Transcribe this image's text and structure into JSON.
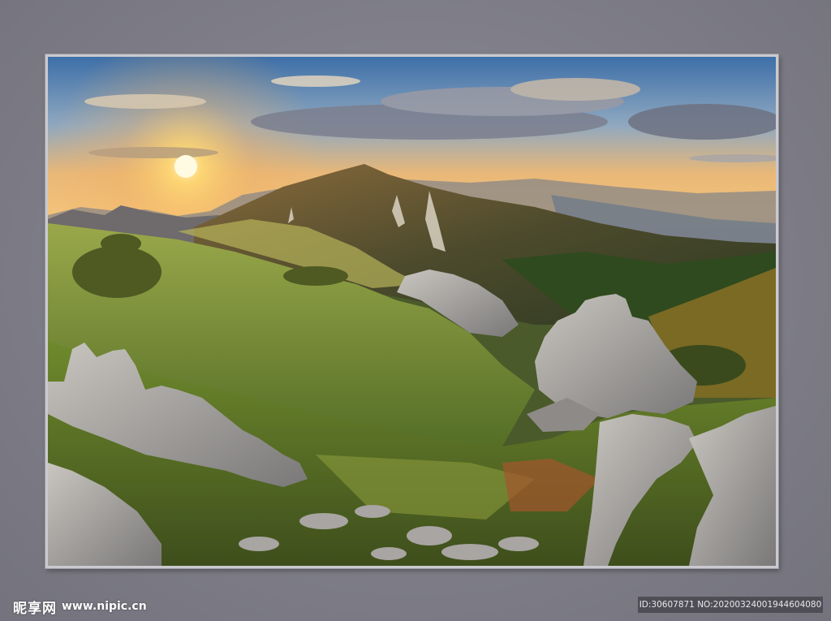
{
  "watermark": {
    "brand": "昵享网",
    "url": "www.nipic.cn",
    "id_text": "ID:30607871 NO:20200324001944604080"
  },
  "colors": {
    "wall": "#7f7e88",
    "frame": "#c9c9cf",
    "sky_top": "#3d6fa8",
    "sun": "#ffd873",
    "grass": "#6c8a2c",
    "rock": "#9c9ca0"
  }
}
